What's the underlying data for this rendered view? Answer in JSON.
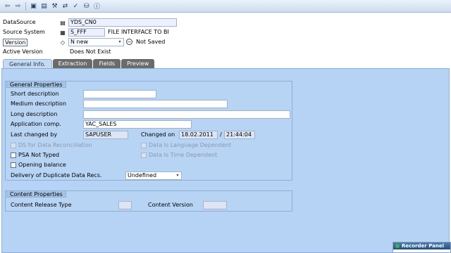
{
  "toolbar": {
    "icons": [
      "back-icon",
      "forward-icon",
      "save-icon",
      "display-icon",
      "tools-icon",
      "transport-icon",
      "check-icon",
      "database-icon",
      "info-icon"
    ]
  },
  "header": {
    "datasource_label": "DataSource",
    "datasource_value": "YDS_CN0",
    "source_system_label": "Source System",
    "source_system_value": "S_FFF",
    "source_system_desc": "FILE INTERFACE TO BI",
    "version_label": "Version",
    "version_value": "N new",
    "version_status": "Not Saved",
    "active_version_label": "Active Version",
    "active_version_value": "Does Not Exist"
  },
  "tabs": [
    {
      "label": "General Info.",
      "active": true
    },
    {
      "label": "Extraction",
      "active": false
    },
    {
      "label": "Fields",
      "active": false
    },
    {
      "label": "Preview",
      "active": false
    }
  ],
  "general_properties": {
    "title": "General Properties",
    "short_description_label": "Short description",
    "short_description_value": "",
    "medium_description_label": "Medium description",
    "medium_description_value": "",
    "long_description_label": "Long description",
    "long_description_value": "",
    "application_comp_label": "Application comp.",
    "application_comp_value": "YAC_SALES",
    "last_changed_by_label": "Last changed by",
    "last_changed_by_value": "SAPUSER",
    "changed_on_label": "Changed on",
    "changed_on_date": "18.02.2011",
    "changed_on_sep": "/",
    "changed_on_time": "21:44:04",
    "ds_reconciliation_label": "DS for Data Reconciliation",
    "lang_dependent_label": "Data Is Language Dependent",
    "psa_not_typed_label": "PSA Not Typed",
    "time_dependent_label": "Data Is Time Dependent",
    "opening_balance_label": "Opening balance",
    "duplicate_records_label": "Delivery of Duplicate Data Recs.",
    "duplicate_records_value": "Undefined"
  },
  "content_properties": {
    "title": "Content Properties",
    "release_type_label": "Content Release Type",
    "release_type_value": "",
    "content_version_label": "Content Version",
    "content_version_value": ""
  },
  "recorder": {
    "title": "Recorder Panel"
  }
}
